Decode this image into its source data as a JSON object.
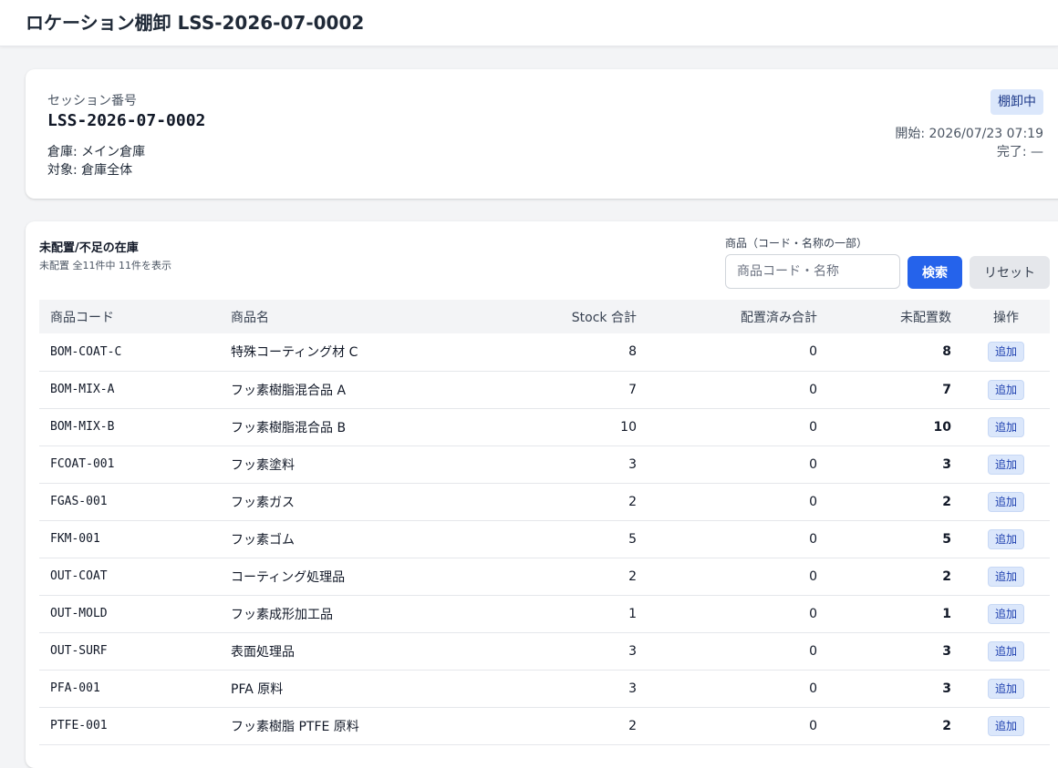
{
  "header": {
    "title": "ロケーション棚卸 LSS-2026-07-0002"
  },
  "session": {
    "label": "セッション番号",
    "number": "LSS-2026-07-0002",
    "warehouse": "倉庫: メイン倉庫",
    "target": "対象: 倉庫全体",
    "status": "棚卸中",
    "started": "開始: 2026/07/23 07:19",
    "completed": "完了: —"
  },
  "list": {
    "title": "未配置/不足の在庫",
    "subtitle": "未配置 全11件中 11件を表示",
    "search": {
      "label": "商品（コード・名称の一部）",
      "placeholder": "商品コード・名称",
      "value": "",
      "search_button": "検索",
      "reset_button": "リセット"
    },
    "columns": [
      "商品コード",
      "商品名",
      "Stock 合計",
      "配置済み合計",
      "未配置数",
      "操作"
    ],
    "add_label": "追加",
    "rows": [
      {
        "code": "BOM-COAT-C",
        "name": "特殊コーティング材 C",
        "stock": "8",
        "placed": "0",
        "unplaced": "8"
      },
      {
        "code": "BOM-MIX-A",
        "name": "フッ素樹脂混合品 A",
        "stock": "7",
        "placed": "0",
        "unplaced": "7"
      },
      {
        "code": "BOM-MIX-B",
        "name": "フッ素樹脂混合品 B",
        "stock": "10",
        "placed": "0",
        "unplaced": "10"
      },
      {
        "code": "FCOAT-001",
        "name": "フッ素塗料",
        "stock": "3",
        "placed": "0",
        "unplaced": "3"
      },
      {
        "code": "FGAS-001",
        "name": "フッ素ガス",
        "stock": "2",
        "placed": "0",
        "unplaced": "2"
      },
      {
        "code": "FKM-001",
        "name": "フッ素ゴム",
        "stock": "5",
        "placed": "0",
        "unplaced": "5"
      },
      {
        "code": "OUT-COAT",
        "name": "コーティング処理品",
        "stock": "2",
        "placed": "0",
        "unplaced": "2"
      },
      {
        "code": "OUT-MOLD",
        "name": "フッ素成形加工品",
        "stock": "1",
        "placed": "0",
        "unplaced": "1"
      },
      {
        "code": "OUT-SURF",
        "name": "表面処理品",
        "stock": "3",
        "placed": "0",
        "unplaced": "3"
      },
      {
        "code": "PFA-001",
        "name": "PFA 原料",
        "stock": "3",
        "placed": "0",
        "unplaced": "3"
      },
      {
        "code": "PTFE-001",
        "name": "フッ素樹脂 PTFE 原料",
        "stock": "2",
        "placed": "0",
        "unplaced": "2"
      }
    ]
  }
}
